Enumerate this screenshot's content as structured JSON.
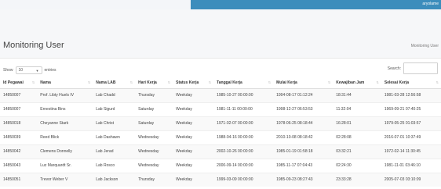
{
  "header": {
    "user_name": "aryolame"
  },
  "page": {
    "title": "Monitoring User",
    "breadcrumb": "Monitoring User"
  },
  "controls": {
    "show_label": "Show",
    "entries_value": "10",
    "entries_label": "entries",
    "search_label": "Search:",
    "search_placeholder": ""
  },
  "table": {
    "columns": [
      "Id Pegawai",
      "Nama",
      "Nama LAB",
      "Hari Kerja",
      "Status Kerja",
      "Tanggal Kerja",
      "Mulai Kerja",
      "Kewajiban Jam",
      "Selesai Kerja"
    ],
    "rows": [
      [
        "14850007",
        "Prof. Libty Huels IV",
        "Lab Chadd",
        "Thursday",
        "Weekday",
        "1985-10-27 00:00:00",
        "1994-08-17 01:12:24",
        "18:31:44",
        "1981-03-28 12:56:58"
      ],
      [
        "14850007",
        "Ernestina Bins",
        "Lab Sigurd",
        "Saturday",
        "Weekday",
        "1981-11-11 00:00:00",
        "1998-12-27 06:53:53",
        "11:32:04",
        "1969-09-21 07:40:25"
      ],
      [
        "14850018",
        "Cheyanne Stark",
        "Lab Christ",
        "Saturday",
        "Weekday",
        "1971-02-07 00:00:00",
        "1978-06-25 08:18:44",
        "16:28:01",
        "1979-05-25 01:03:57"
      ],
      [
        "14850039",
        "Reed Blick",
        "Lab Dashawn",
        "Wednesday",
        "Weekday",
        "1988-04-16 00:00:00",
        "2010-10-08 08:18:42",
        "02:28:08",
        "2016-07-01 10:37:49"
      ],
      [
        "14850042",
        "Clemens Donnelly",
        "Lab Jerad",
        "Wednesday",
        "Weekday",
        "2002-10-26 00:00:00",
        "1985-01-19 01:58:18",
        "03:32:21",
        "1972-02-14 11:30:45"
      ],
      [
        "14850043",
        "Luz Marquardt Sr.",
        "Lab Rosco",
        "Wednesday",
        "Weekday",
        "2000-09-14 00:00:00",
        "1985-11-17 07:04:43",
        "02:24:30",
        "1981-11-01 03:46:10"
      ],
      [
        "14850051",
        "Trevor Weber V",
        "Lab Jackson",
        "Thursday",
        "Weekday",
        "1999-03-09 00:00:00",
        "1985-09-23 08:27:43",
        "23:33:28",
        "2005-07-03 03:10:09"
      ]
    ]
  },
  "icons": {
    "sort": "sort-arrows-icon",
    "dropdown": "chevron-down-icon"
  }
}
